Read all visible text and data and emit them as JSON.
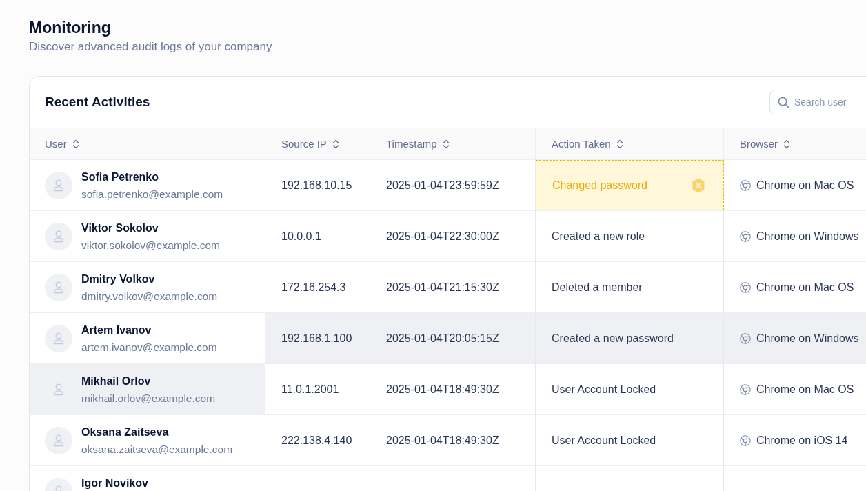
{
  "page": {
    "title": "Monitoring",
    "subtitle": "Discover advanced audit logs of your company"
  },
  "card": {
    "title": "Recent Activities",
    "search": {
      "placeholder": "Search user"
    }
  },
  "table": {
    "columns": [
      {
        "label": "User"
      },
      {
        "label": "Source IP"
      },
      {
        "label": "Timestamp"
      },
      {
        "label": "Action Taken"
      },
      {
        "label": "Browser"
      }
    ],
    "rows": [
      {
        "name": "Sofia Petrenko",
        "email": "sofia.petrenko@example.com",
        "source_ip": "192.168.10.15",
        "timestamp": "2025-01-04T23:59:59Z",
        "action": "Changed password",
        "flagged": true,
        "browser": "Chrome on Mac OS",
        "highlighted": false,
        "user_cell_highlighted": false
      },
      {
        "name": "Viktor Sokolov",
        "email": "viktor.sokolov@example.com",
        "source_ip": "10.0.0.1",
        "timestamp": "2025-01-04T22:30:00Z",
        "action": "Created a new role",
        "flagged": false,
        "browser": "Chrome on Windows",
        "highlighted": false,
        "user_cell_highlighted": false
      },
      {
        "name": "Dmitry Volkov",
        "email": "dmitry.volkov@example.com",
        "source_ip": "172.16.254.3",
        "timestamp": "2025-01-04T21:15:30Z",
        "action": "Deleted a member",
        "flagged": false,
        "browser": "Chrome on Mac OS",
        "highlighted": false,
        "user_cell_highlighted": false
      },
      {
        "name": "Artem Ivanov",
        "email": "artem.ivanov@example.com",
        "source_ip": "192.168.1.100",
        "timestamp": "2025-01-04T20:05:15Z",
        "action": "Created a new password",
        "flagged": false,
        "browser": "Chrome on Windows",
        "highlighted": true,
        "user_cell_highlighted": false
      },
      {
        "name": "Mikhail Orlov",
        "email": "mikhail.orlov@example.com",
        "source_ip": "11.0.1.2001",
        "timestamp": "2025-01-04T18:49:30Z",
        "action": "User Account Locked",
        "flagged": false,
        "browser": "Chrome on Mac OS",
        "highlighted": false,
        "user_cell_highlighted": true
      },
      {
        "name": "Oksana Zaitseva",
        "email": "oksana.zaitseva@example.com",
        "source_ip": "222.138.4.140",
        "timestamp": "2025-01-04T18:49:30Z",
        "action": "User Account Locked",
        "flagged": false,
        "browser": "Chrome on iOS 14",
        "highlighted": false,
        "user_cell_highlighted": false
      },
      {
        "name": "Igor Novikov",
        "flagged": false,
        "highlighted": false,
        "user_cell_highlighted": false
      }
    ]
  }
}
